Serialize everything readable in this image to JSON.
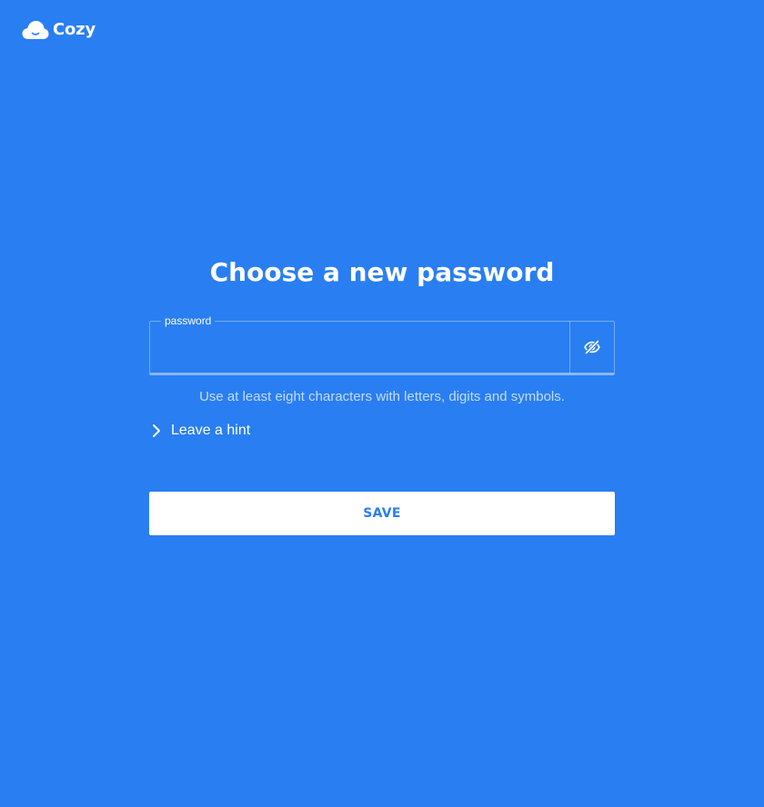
{
  "brand": {
    "name": "Cozy",
    "icon": "cloud-smile-icon"
  },
  "page": {
    "title": "Choose a new password"
  },
  "password_field": {
    "legend": "password",
    "value": "",
    "placeholder": "",
    "visibility_icon": "eye-off-icon"
  },
  "help_text": "Use at least eight characters with letters, digits and symbols.",
  "hint": {
    "label": "Leave a hint",
    "icon": "chevron-right-icon"
  },
  "save_button": {
    "label": "SAVE"
  },
  "colors": {
    "background": "#297ef2",
    "button_background": "#ffffff",
    "button_text": "#297ef2"
  }
}
